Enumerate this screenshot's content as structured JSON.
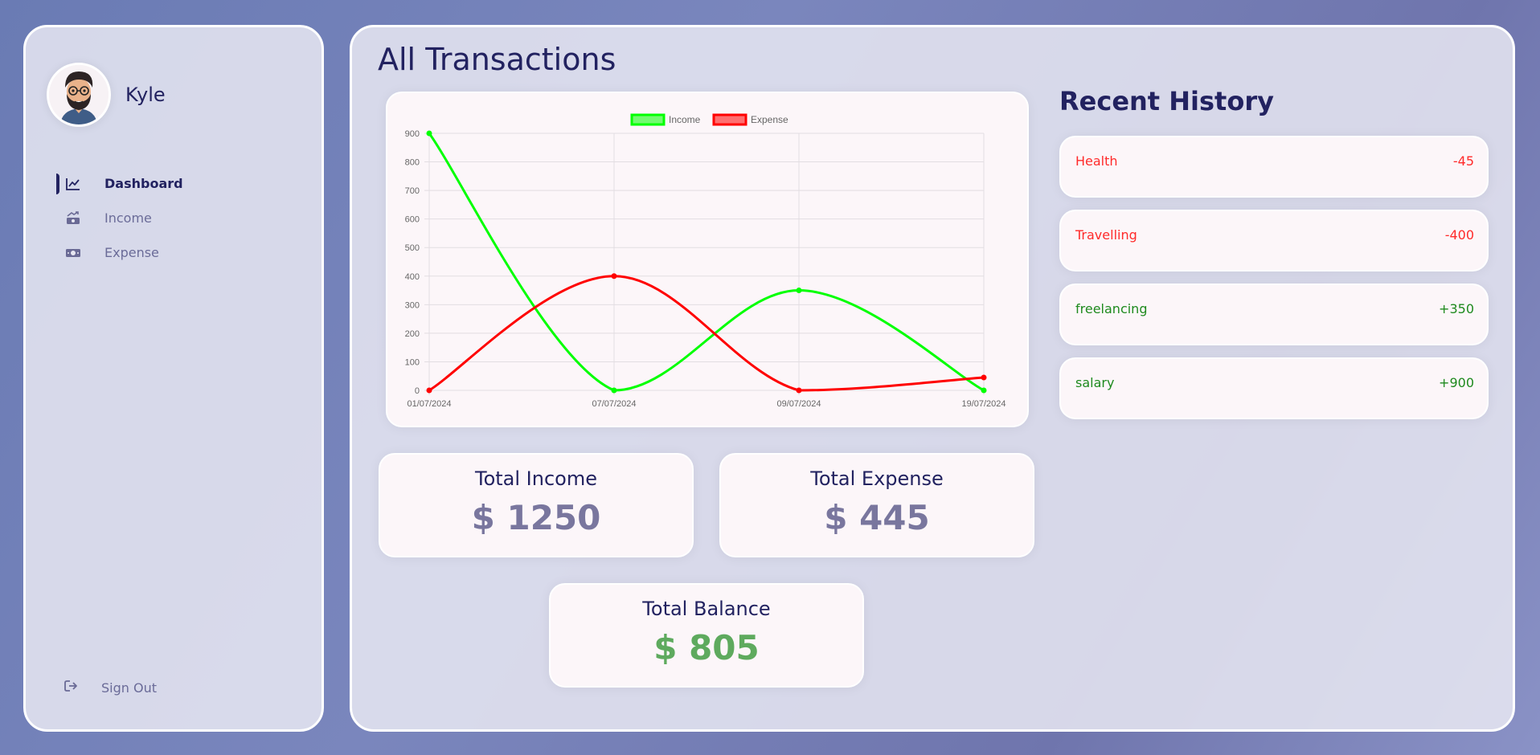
{
  "user": {
    "name": "Kyle"
  },
  "nav": {
    "items": [
      {
        "label": "Dashboard",
        "icon": "chart-line-icon",
        "active": true
      },
      {
        "label": "Income",
        "icon": "money-trend-icon",
        "active": false
      },
      {
        "label": "Expense",
        "icon": "money-bill-icon",
        "active": false
      }
    ],
    "signout": {
      "label": "Sign Out",
      "icon": "sign-out-icon"
    }
  },
  "main": {
    "title": "All Transactions",
    "totals": {
      "income_label": "Total Income",
      "income_value": "$ 1250",
      "expense_label": "Total Expense",
      "expense_value": "$ 445",
      "balance_label": "Total Balance",
      "balance_value": "$ 805"
    },
    "history": {
      "title": "Recent History",
      "items": [
        {
          "title": "Health",
          "amount": "-45",
          "type": "expense"
        },
        {
          "title": "Travelling",
          "amount": "-400",
          "type": "expense"
        },
        {
          "title": "freelancing",
          "amount": "+350",
          "type": "income"
        },
        {
          "title": "salary",
          "amount": "+900",
          "type": "income"
        }
      ]
    }
  },
  "colors": {
    "primary": "#222260",
    "income_line": "#00ff00",
    "expense_line": "#ff0000",
    "balance": "#5eaa5e"
  },
  "chart_data": {
    "type": "line",
    "categories": [
      "01/07/2024",
      "07/07/2024",
      "09/07/2024",
      "19/07/2024"
    ],
    "series": [
      {
        "name": "Income",
        "values": [
          900,
          0,
          350,
          0
        ],
        "color": "#00ff00"
      },
      {
        "name": "Expense",
        "values": [
          0,
          400,
          0,
          45
        ],
        "color": "#ff0000"
      }
    ],
    "yticks": [
      0,
      100,
      200,
      300,
      400,
      500,
      600,
      700,
      800,
      900
    ],
    "ylim": [
      0,
      900
    ],
    "legend": "top",
    "grid": true
  }
}
